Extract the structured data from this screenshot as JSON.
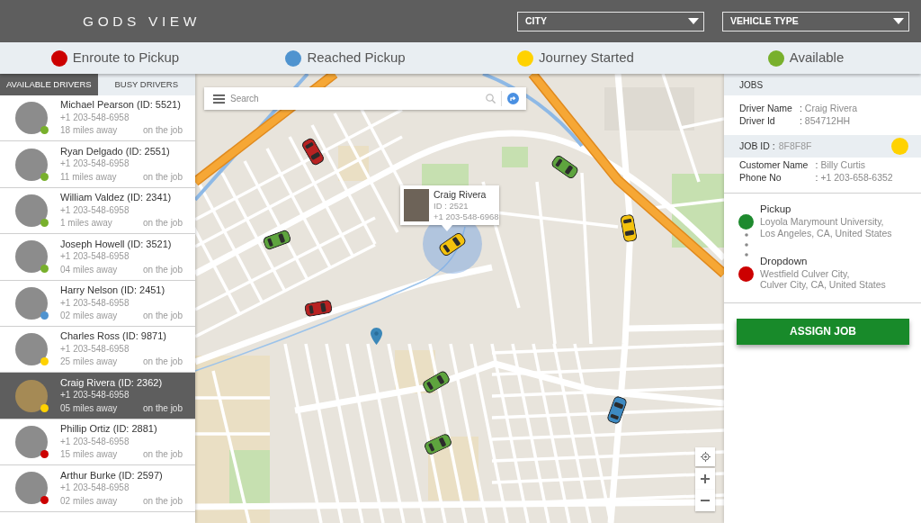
{
  "header": {
    "title": "GODS VIEW",
    "filters": [
      {
        "label": "CITY"
      },
      {
        "label": "VEHICLE TYPE"
      }
    ]
  },
  "legend": [
    {
      "label": "Enroute to Pickup",
      "color": "#cc0000"
    },
    {
      "label": "Reached Pickup",
      "color": "#4f93cf"
    },
    {
      "label": "Journey Started",
      "color": "#ffd200"
    },
    {
      "label": "Available",
      "color": "#78b02c"
    }
  ],
  "sidebar": {
    "tabs": [
      {
        "label": "AVAILABLE DRIVERS",
        "selected": true
      },
      {
        "label": "BUSY DRIVERS",
        "selected": false
      }
    ],
    "drivers": [
      {
        "name": "Michael Pearson (ID: 5521)",
        "phone": "+1 203-548-6958",
        "distance": "18 miles away",
        "status": "on the job",
        "color": "#78b02c",
        "selected": false
      },
      {
        "name": "Ryan Delgado (ID: 2551)",
        "phone": "+1 203-548-6958",
        "distance": "11 miles away",
        "status": "on the job",
        "color": "#78b02c",
        "selected": false
      },
      {
        "name": "William Valdez (ID: 2341)",
        "phone": "+1 203-548-6958",
        "distance": "1 miles away",
        "status": "on the job",
        "color": "#78b02c",
        "selected": false
      },
      {
        "name": "Joseph Howell (ID: 3521)",
        "phone": "+1 203-548-6958",
        "distance": "04 miles away",
        "status": "on the job",
        "color": "#78b02c",
        "selected": false
      },
      {
        "name": "Harry Nelson (ID: 2451)",
        "phone": "+1 203-548-6958",
        "distance": "02 miles away",
        "status": "on the job",
        "color": "#4f93cf",
        "selected": false
      },
      {
        "name": "Charles Ross (ID: 9871)",
        "phone": "+1 203-548-6958",
        "distance": "25 miles away",
        "status": "on the job",
        "color": "#ffd200",
        "selected": false
      },
      {
        "name": "Craig Rivera (ID: 2362)",
        "phone": "+1 203-548-6958",
        "distance": "05 miles away",
        "status": "on the job",
        "color": "#ffd200",
        "selected": true
      },
      {
        "name": "Phillip Ortiz (ID: 2881)",
        "phone": "+1 203-548-6958",
        "distance": "15 miles away",
        "status": "on the job",
        "color": "#cc0000",
        "selected": false
      },
      {
        "name": "Arthur Burke (ID: 2597)",
        "phone": "+1 203-548-6958",
        "distance": "02 miles away",
        "status": "on the job",
        "color": "#cc0000",
        "selected": false
      }
    ]
  },
  "map": {
    "search": {
      "placeholder": "Search"
    },
    "popup": {
      "name": "Craig Rivera",
      "id": "ID : 2521",
      "phone": "+1 203-548-6968"
    },
    "cars": [
      {
        "color": "#b82222",
        "selected": false
      },
      {
        "color": "#5ea43e",
        "selected": false
      },
      {
        "color": "#f4c20d",
        "selected": true
      },
      {
        "color": "#f4c20d",
        "selected": false
      },
      {
        "color": "#5ea43e",
        "selected": false
      },
      {
        "color": "#b82222",
        "selected": false
      },
      {
        "color": "#5ea43e",
        "selected": false
      },
      {
        "color": "#3d8ac2",
        "selected": false
      },
      {
        "color": "#5ea43e",
        "selected": false
      }
    ]
  },
  "jobs": {
    "title": "JOBS",
    "driver": [
      {
        "label": "Driver Name",
        "sep": ":",
        "value": "Craig Rivera"
      },
      {
        "label": "Driver Id",
        "sep": ":",
        "value": "854712HH"
      }
    ],
    "job": {
      "label": "JOB ID :",
      "value": "8F8F8F",
      "color": "#ffd200"
    },
    "customer": [
      {
        "label": "Customer Name",
        "sep": ":",
        "value": "Billy Curtis"
      },
      {
        "label": "Phone No",
        "sep": ":",
        "value": "+1 203-658-6352"
      }
    ],
    "route": [
      {
        "label": "Pickup",
        "address": "Loyola Marymount University,\nLos Angeles, CA, United States",
        "color": "#1e8a2e"
      },
      {
        "label": "Dropdown",
        "address": "Westfield Culver City,\nCulver City, CA, United States",
        "color": "#cc0000"
      }
    ],
    "button": "ASSIGN JOB"
  }
}
